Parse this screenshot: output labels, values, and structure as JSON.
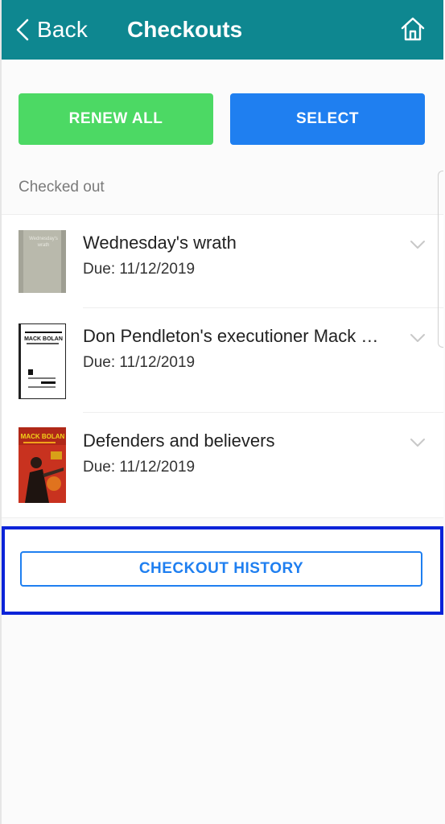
{
  "header": {
    "back_label": "Back",
    "title": "Checkouts",
    "back_icon": "chevron-left-icon",
    "home_icon": "home-icon",
    "bg_color": "#0e8790"
  },
  "actions": {
    "renew_all_label": "RENEW ALL",
    "select_label": "SELECT",
    "renew_color": "#4cd964",
    "select_color": "#1f7ff0"
  },
  "section": {
    "label": "Checked out"
  },
  "items": [
    {
      "title": "Wednesday's wrath",
      "due": "Due: 11/12/2019",
      "cover_text": "Wednesday's wrath"
    },
    {
      "title": "Don Pendleton's executioner Mack …",
      "due": "Due: 11/12/2019",
      "cover_text": "MACK BOLAN"
    },
    {
      "title": "Defenders and believers",
      "due": "Due: 11/12/2019",
      "cover_text": "MACK BOLAN"
    }
  ],
  "history": {
    "label": "CHECKOUT HISTORY",
    "highlight_color": "#0a23d8"
  }
}
